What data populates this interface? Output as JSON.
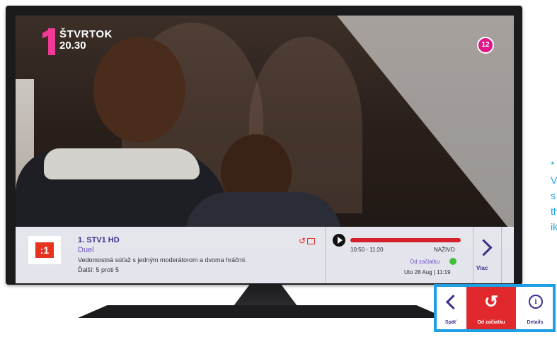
{
  "overlay": {
    "day": "ŠTVRTOK",
    "time": "20.30",
    "age_rating": "12"
  },
  "channel": {
    "logo_text": ":1",
    "name": "1. STV1 HD",
    "program_title": "Duel",
    "description": "Vedomostná súťaž s jedným moderátorom a dvoma hráčmi.",
    "next": "Ďalší: 5 proti 5"
  },
  "playback": {
    "range": "10:50 - 11:20",
    "live_label": "NAŽIVO",
    "progress": 1.0,
    "progress_color": "#d3202a",
    "restart_label": "Od začiatku",
    "date": "Uto 28 Aug | 11:19"
  },
  "more": {
    "label": "Viac"
  },
  "remote": {
    "back": "Späť",
    "restart": "Od začiatku",
    "details": "Details"
  },
  "side_note": [
    "*",
    "V",
    "s",
    "th",
    "ik"
  ],
  "colors": {
    "accent": "#3d2f8e",
    "restart_red": "#e0282d",
    "highlight_blue": "#1f9fe3",
    "live_green": "#3fbf3a",
    "brand_pink": "#f03a96"
  }
}
